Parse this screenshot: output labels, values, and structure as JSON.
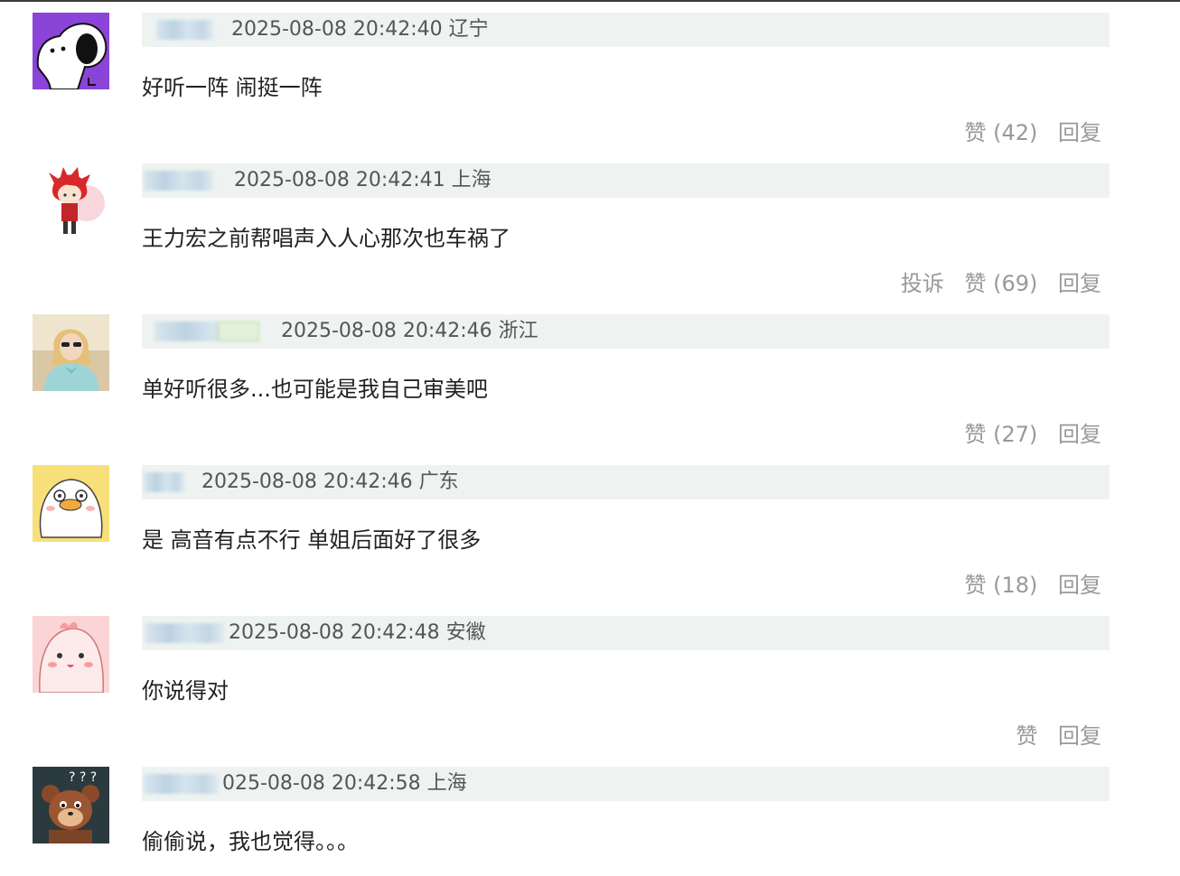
{
  "comments": [
    {
      "meta": "2025-08-08 20:42:40 辽宁",
      "content": "好听一阵 闹挺一阵",
      "like_label": "赞 (42)",
      "reply_label": "回复",
      "report_label": ""
    },
    {
      "meta": "2025-08-08 20:42:41 上海",
      "content": "王力宏之前帮唱声入人心那次也车祸了",
      "like_label": "赞 (69)",
      "reply_label": "回复",
      "report_label": "投诉"
    },
    {
      "meta": "2025-08-08 20:42:46 浙江",
      "content": "单好听很多...也可能是我自己审美吧",
      "like_label": "赞 (27)",
      "reply_label": "回复",
      "report_label": ""
    },
    {
      "meta": "2025-08-08 20:42:46 广东",
      "content": "是 高音有点不行 单姐后面好了很多",
      "like_label": "赞 (18)",
      "reply_label": "回复",
      "report_label": ""
    },
    {
      "meta": "2025-08-08 20:42:48 安徽",
      "content": "你说得对",
      "like_label": "赞",
      "reply_label": "回复",
      "report_label": ""
    },
    {
      "meta": "025-08-08 20:42:58 上海",
      "content": "偷偷说，我也觉得。。。",
      "like_label": "",
      "reply_label": "",
      "report_label": ""
    }
  ],
  "avatar_icons": [
    "snoopy-dog-icon",
    "red-hair-boy-icon",
    "blonde-girl-photo-icon",
    "cartoon-duck-icon",
    "pink-blob-icon",
    "jerry-mouse-icon"
  ],
  "colors": {
    "meta_bar": "#eef3f1",
    "action_text": "#999999",
    "content_text": "#222222"
  }
}
